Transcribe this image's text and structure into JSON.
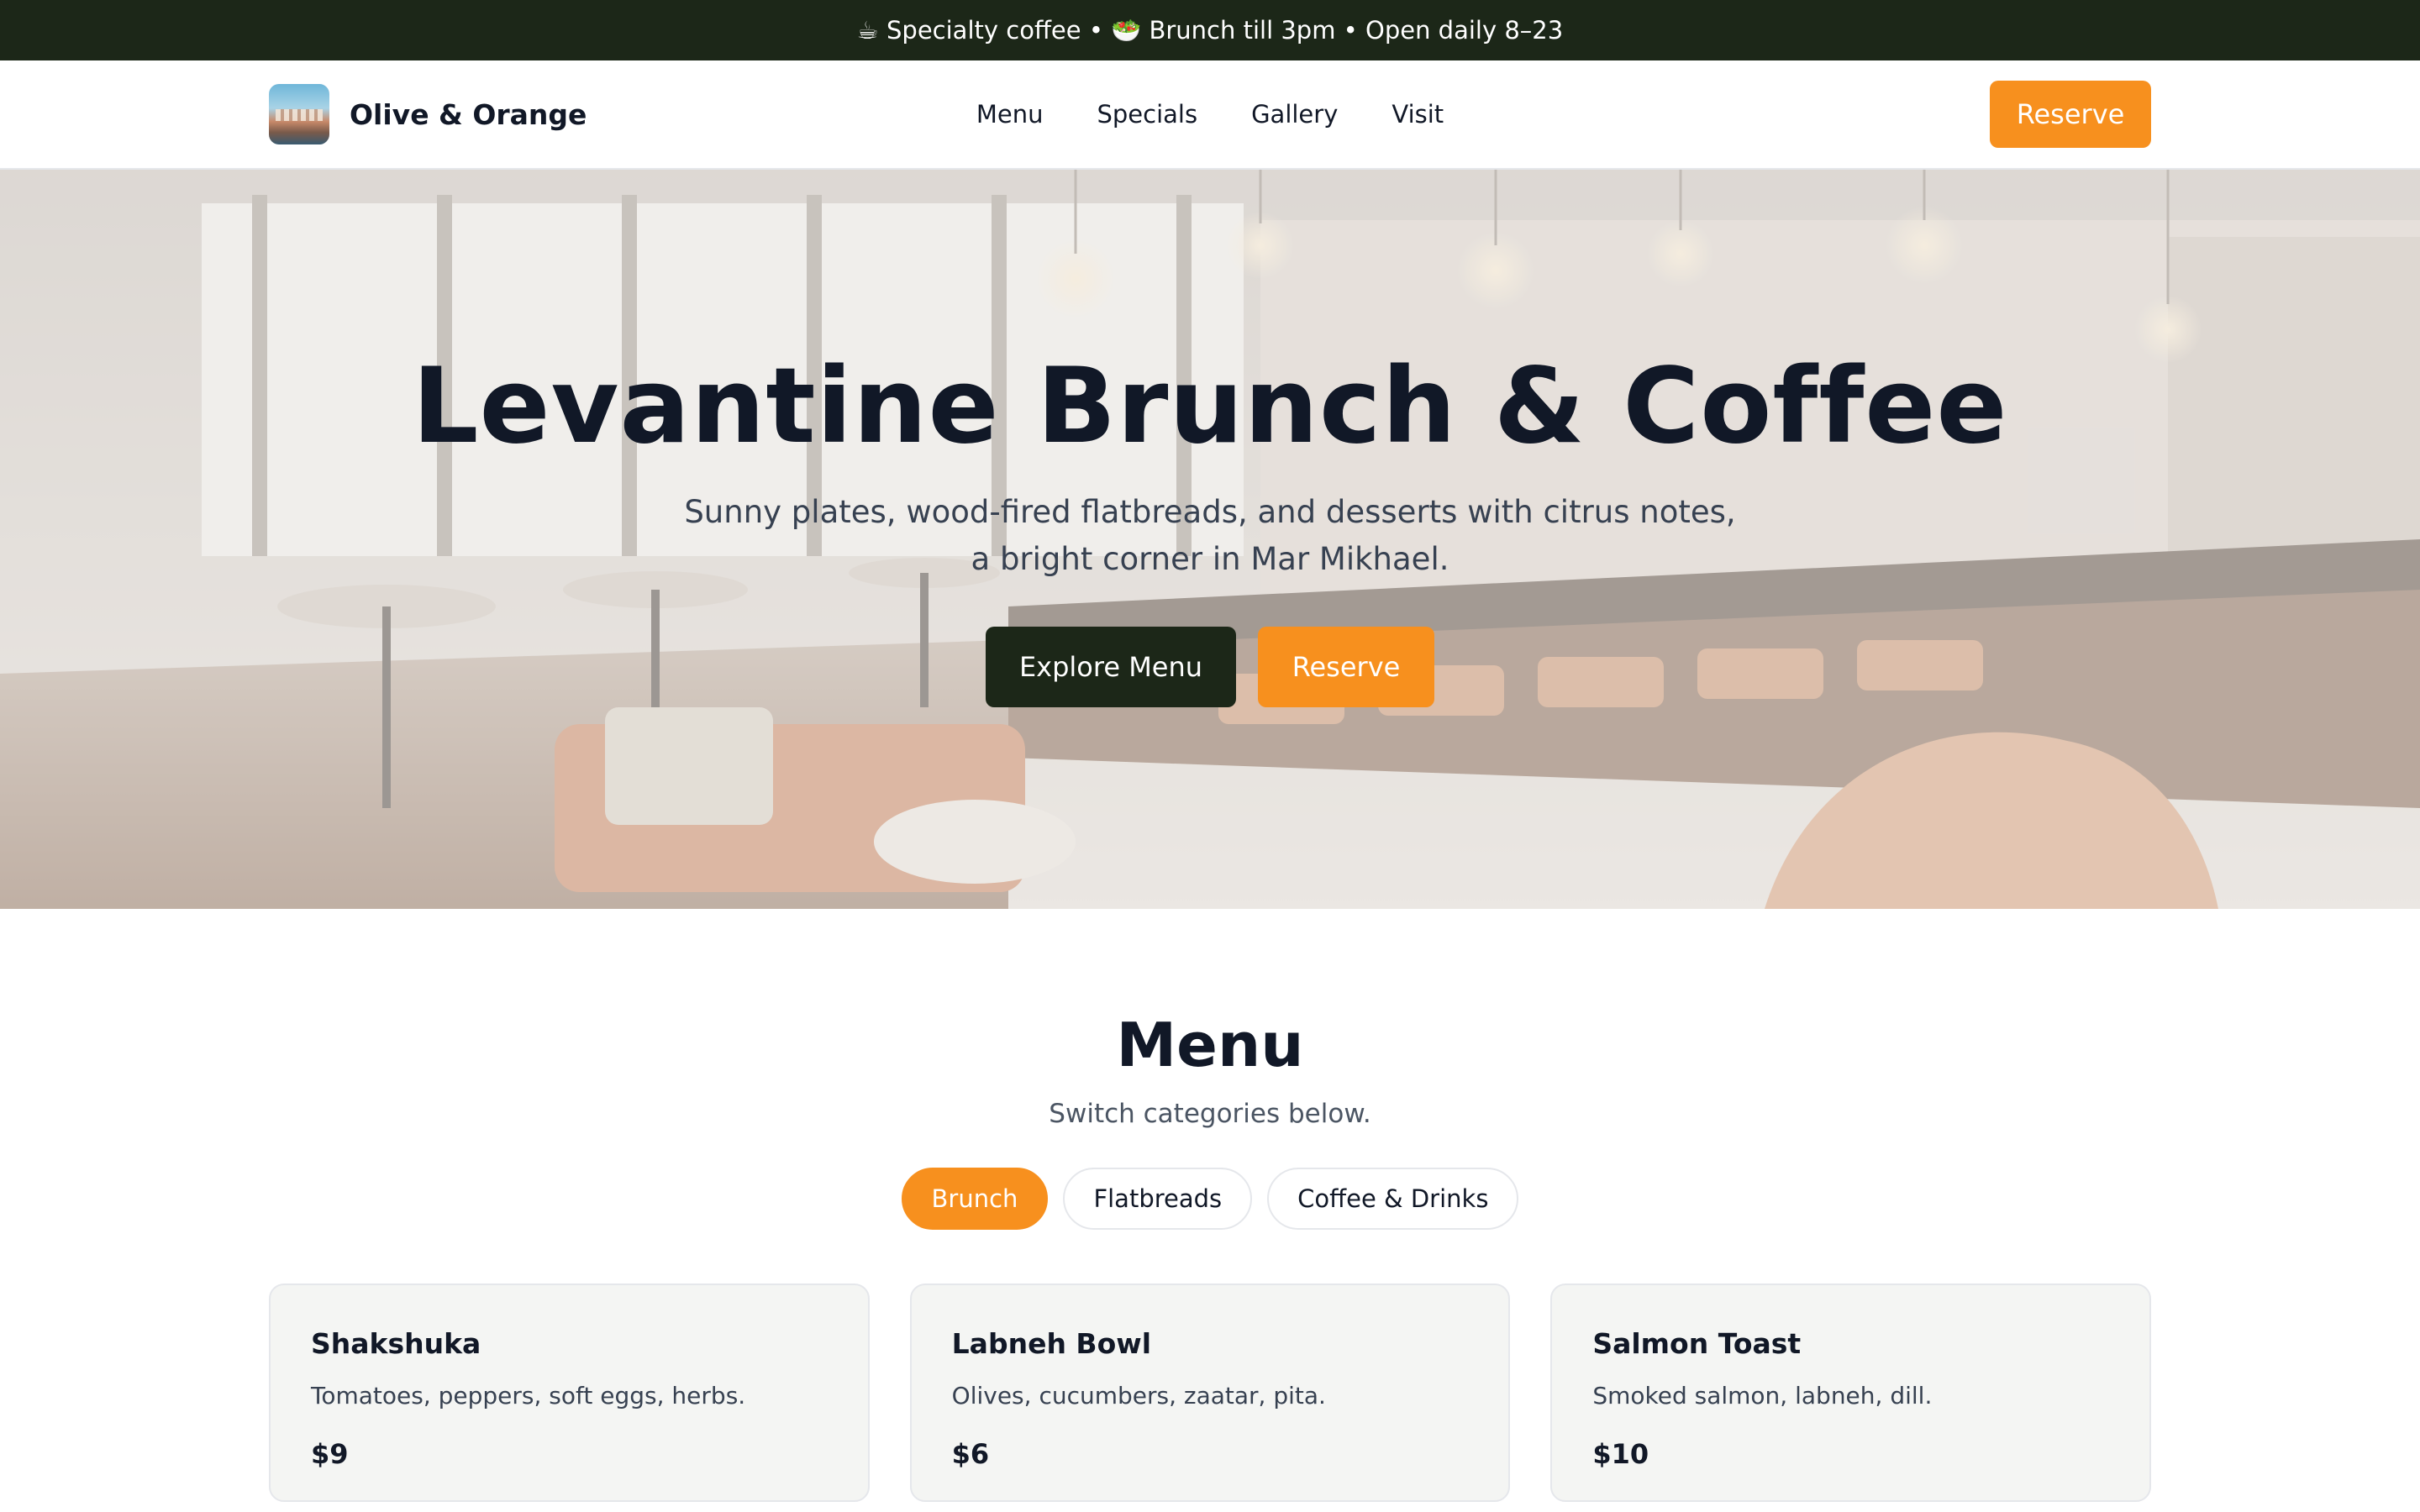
{
  "announcement": "☕ Specialty coffee • 🥗 Brunch till 3pm • Open daily 8–23",
  "header": {
    "brand_name": "Olive & Orange",
    "nav": [
      "Menu",
      "Specials",
      "Gallery",
      "Visit"
    ],
    "reserve_label": "Reserve"
  },
  "hero": {
    "title": "Levantine Brunch & Coffee",
    "subtitle": "Sunny plates, wood-fired flatbreads, and desserts with citrus notes, a bright corner in Mar Mikhael.",
    "primary_label": "Explore Menu",
    "secondary_label": "Reserve"
  },
  "menu": {
    "title": "Menu",
    "subtitle": "Switch categories below.",
    "tabs": [
      {
        "label": "Brunch",
        "active": true
      },
      {
        "label": "Flatbreads",
        "active": false
      },
      {
        "label": "Coffee & Drinks",
        "active": false
      }
    ],
    "items": [
      {
        "name": "Shakshuka",
        "description": "Tomatoes, peppers, soft eggs, herbs.",
        "price": "$9"
      },
      {
        "name": "Labneh Bowl",
        "description": "Olives, cucumbers, zaatar, pita.",
        "price": "$6"
      },
      {
        "name": "Salmon Toast",
        "description": "Smoked salmon, labneh, dill.",
        "price": "$10"
      }
    ]
  },
  "colors": {
    "accent": "#f7901e",
    "dark": "#1c2718",
    "text": "#111827"
  }
}
